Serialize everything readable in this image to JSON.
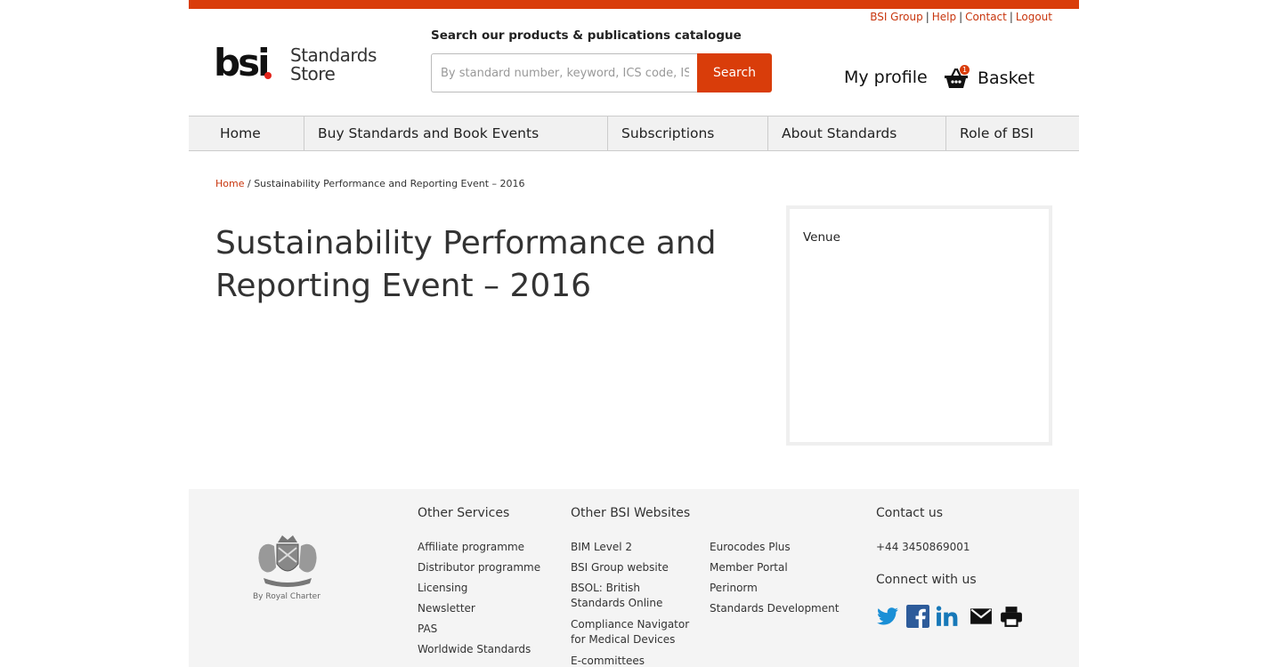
{
  "utility_links": [
    "BSI Group",
    "Help",
    "Contact",
    "Logout"
  ],
  "logo": {
    "brand": "bsi",
    "product_line1": "Standards",
    "product_line2": "Store"
  },
  "search": {
    "label": "Search our products & publications catalogue",
    "placeholder": "By standard number, keyword, ICS code, ISBN",
    "button": "Search"
  },
  "header": {
    "profile": "My profile",
    "basket": "Basket",
    "basket_count": "1"
  },
  "nav": [
    "Home",
    "Buy Standards and Book Events",
    "Subscriptions",
    "About Standards",
    "Role of BSI"
  ],
  "breadcrumb": {
    "home": "Home",
    "separator": "/",
    "current": "Sustainability Performance and Reporting Event – 2016"
  },
  "main": {
    "title": "Sustainability Performance and Reporting Event – 2016",
    "venue_label": "Venue"
  },
  "footer": {
    "crest_caption": "By Royal Charter",
    "other_services": {
      "heading": "Other Services",
      "links": [
        "Affiliate programme",
        "Distributor programme",
        "Licensing",
        "Newsletter",
        "PAS",
        "Worldwide Standards"
      ]
    },
    "other_websites": {
      "heading": "Other BSI Websites",
      "col1": [
        "BIM Level 2",
        "BSI Group website",
        "BSOL: British Standards Online",
        "Compliance Navigator for Medical Devices",
        "E-committees"
      ],
      "col2": [
        "Eurocodes Plus",
        "Member Portal",
        "Perinorm",
        "Standards Development"
      ]
    },
    "contact": {
      "heading": "Contact us",
      "phone": "+44 3450869001",
      "connect_heading": "Connect with us"
    }
  },
  "colors": {
    "accent": "#d93d0a",
    "link": "#c8350d",
    "nav_bg": "#f1f1f1",
    "footer_bg": "#f4f4f4"
  },
  "icons": [
    "basket-icon",
    "royal-charter-crest-icon",
    "twitter-icon",
    "facebook-icon",
    "linkedin-icon",
    "email-icon",
    "print-icon"
  ]
}
